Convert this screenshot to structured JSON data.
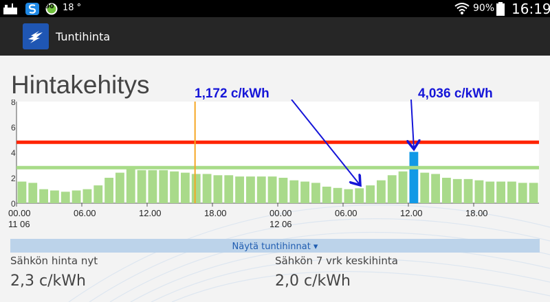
{
  "statusbar": {
    "temperature": "18 °",
    "badge_number": "90",
    "battery": "90%",
    "time": "16:19"
  },
  "app": {
    "title": "Tuntihinta"
  },
  "page": {
    "title": "Hintakehitys"
  },
  "chart_data": {
    "type": "bar",
    "unit": "c/kWh",
    "ylim": [
      0,
      8
    ],
    "yticks": [
      "0",
      "2",
      "4",
      "6",
      "8"
    ],
    "x_labels": [
      {
        "hour": 0,
        "time": "00.00",
        "date": "11 06"
      },
      {
        "hour": 6,
        "time": "06.00"
      },
      {
        "hour": 12,
        "time": "12.00"
      },
      {
        "hour": 18,
        "time": "18.00"
      },
      {
        "hour": 24,
        "time": "00.00",
        "date": "12 06"
      },
      {
        "hour": 30,
        "time": "06.00"
      },
      {
        "hour": 36,
        "time": "12.00"
      },
      {
        "hour": 42,
        "time": "18.00"
      }
    ],
    "values": [
      1.7,
      1.6,
      1.1,
      1.0,
      0.9,
      1.0,
      1.1,
      1.4,
      2.0,
      2.4,
      2.7,
      2.6,
      2.6,
      2.6,
      2.5,
      2.4,
      2.3,
      2.3,
      2.2,
      2.2,
      2.1,
      2.1,
      2.1,
      2.1,
      2.0,
      1.8,
      1.7,
      1.6,
      1.3,
      1.2,
      1.1,
      1.172,
      1.4,
      1.8,
      2.2,
      2.5,
      4.036,
      2.4,
      2.3,
      2.0,
      1.9,
      1.9,
      1.8,
      1.7,
      1.7,
      1.7,
      1.6,
      1.6
    ],
    "highlight_index": 36,
    "reference_lines": [
      {
        "name": "upper",
        "value": 4.8,
        "color": "#ff2400"
      },
      {
        "name": "average",
        "value": 2.8,
        "color": "#a8dc88"
      }
    ],
    "current_hour_marker": 16.4,
    "bar_color": "#a9da8a",
    "highlight_color": "#1199e6",
    "annotations": [
      {
        "text": "1,172 c/kWh",
        "bar_index": 31
      },
      {
        "text": "4,036 c/kWh",
        "bar_index": 36
      }
    ]
  },
  "show_hourly": {
    "label": "Näytä tuntihinnat ▾"
  },
  "stats": {
    "now_label": "Sähkön hinta nyt",
    "now_value": "2,3 c/kWh",
    "avg_label": "Sähkön 7 vrk keskihinta",
    "avg_value": "2,0 c/kWh"
  }
}
